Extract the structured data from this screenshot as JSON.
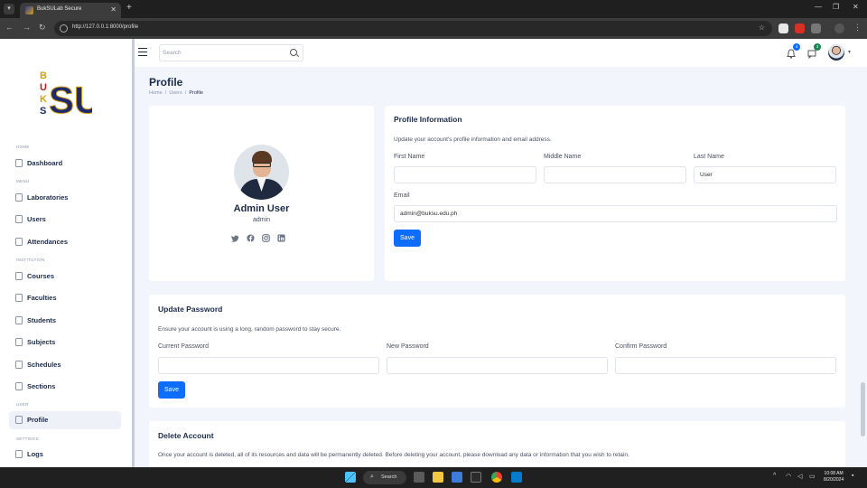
{
  "browser": {
    "tab_title": "BukSULab Secure",
    "url": "http://127.0.0.1:8000/profile"
  },
  "sidebar": {
    "sections": [
      {
        "label": "HOME"
      },
      {
        "label": "MENU"
      },
      {
        "label": "INSTITUTION"
      },
      {
        "label": "USER"
      },
      {
        "label": "SETTINGS"
      }
    ],
    "items": [
      {
        "label": "Dashboard",
        "icon": "dashboard-icon"
      },
      {
        "label": "Laboratories",
        "icon": "lab-icon"
      },
      {
        "label": "Users",
        "icon": "users-icon"
      },
      {
        "label": "Attendances",
        "icon": "attendance-icon"
      },
      {
        "label": "Courses",
        "icon": "courses-icon"
      },
      {
        "label": "Faculties",
        "icon": "faculties-icon"
      },
      {
        "label": "Students",
        "icon": "students-icon"
      },
      {
        "label": "Subjects",
        "icon": "subjects-icon"
      },
      {
        "label": "Schedules",
        "icon": "schedules-icon"
      },
      {
        "label": "Sections",
        "icon": "sections-icon"
      },
      {
        "label": "Profile",
        "icon": "profile-icon"
      },
      {
        "label": "Logs",
        "icon": "logs-icon"
      }
    ]
  },
  "topbar": {
    "search_placeholder": "Search",
    "notification_count": "4",
    "message_count": "3"
  },
  "page": {
    "title": "Profile",
    "breadcrumb": [
      "Home",
      "Users",
      "Profile"
    ]
  },
  "profile_card": {
    "name": "Admin User",
    "role": "admin"
  },
  "profile_info": {
    "title": "Profile Information",
    "description": "Update your account's profile information and email address.",
    "first_name_label": "First Name",
    "middle_name_label": "Middle Name",
    "last_name_label": "Last Name",
    "last_name_value": "User",
    "email_label": "Email",
    "email_value": "admin@buksu.edu.ph",
    "save_label": "Save"
  },
  "update_password": {
    "title": "Update Password",
    "description": "Ensure your account is using a long, random password to stay secure.",
    "current_label": "Current Password",
    "new_label": "New Password",
    "confirm_label": "Confirm Password",
    "save_label": "Save"
  },
  "delete_account": {
    "title": "Delete Account",
    "description": "Once your account is deleted, all of its resources and data will be permanently deleted. Before deleting your account, please download any data or information that you wish to retain."
  },
  "taskbar": {
    "search_label": "Search",
    "time": "10:08 AM",
    "date": "8/20/2024"
  },
  "colors": {
    "primary": "#0d6efd",
    "sidebar_text": "#1c2b4a",
    "background": "#f2f5fb"
  }
}
